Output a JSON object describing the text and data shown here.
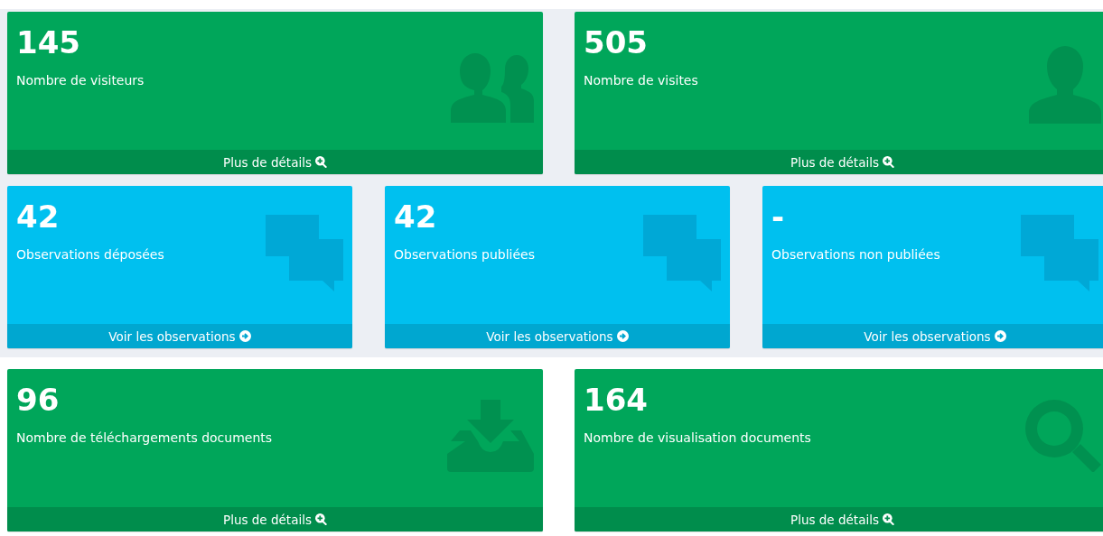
{
  "rows": [
    {
      "cards": [
        {
          "kind": "users",
          "value": "145",
          "label": "Nombre de visiteurs",
          "link": "Plus de détails"
        },
        {
          "kind": "user",
          "value": "505",
          "label": "Nombre de visites",
          "link": "Plus de détails"
        }
      ]
    },
    {
      "cards": [
        {
          "kind": "chat",
          "value": "42",
          "label": "Observations déposées",
          "link": "Voir les observations"
        },
        {
          "kind": "chat",
          "value": "42",
          "label": "Observations publiées",
          "link": "Voir les observations"
        },
        {
          "kind": "chat",
          "value": "-",
          "label": "Observations non publiées",
          "link": "Voir les observations"
        }
      ]
    },
    {
      "cards": [
        {
          "kind": "download",
          "value": "96",
          "label": "Nombre de téléchargements documents",
          "link": "Plus de détails"
        },
        {
          "kind": "search",
          "value": "164",
          "label": "Nombre de visualisation documents",
          "link": "Plus de détails"
        }
      ]
    }
  ]
}
